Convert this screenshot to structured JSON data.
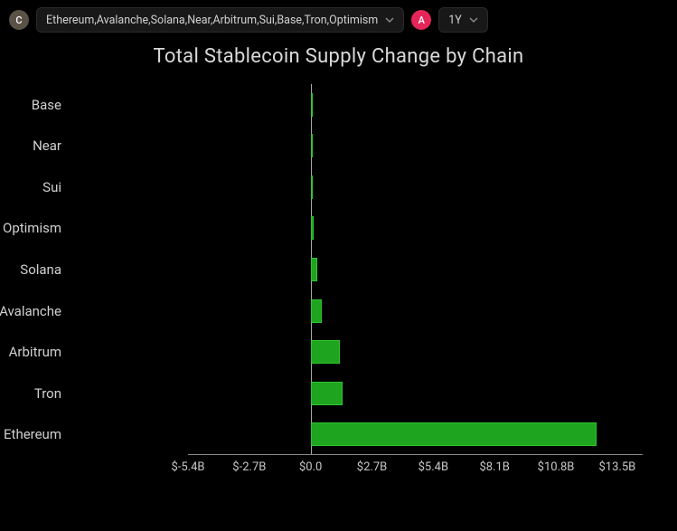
{
  "toolbar": {
    "badge_c": "C",
    "chains_dropdown": "Ethereum,Avalanche,Solana,Near,Arbitrum,Sui,Base,Tron,Optimism",
    "badge_a": "A",
    "range_dropdown": "1Y"
  },
  "chart_data": {
    "type": "bar",
    "orientation": "horizontal",
    "title": "Total Stablecoin Supply Change by Chain",
    "xlabel": "",
    "ylabel": "",
    "x_ticks": [
      "$-5.4B",
      "$-2.7B",
      "$0.0",
      "$2.7B",
      "$5.4B",
      "$8.1B",
      "$10.8B",
      "$13.5B"
    ],
    "x_tick_values": [
      -5.4,
      -2.7,
      0.0,
      2.7,
      5.4,
      8.1,
      10.8,
      13.5
    ],
    "xlim": [
      -5.4,
      14.5
    ],
    "categories": [
      "Base",
      "Near",
      "Sui",
      "Optimism",
      "Solana",
      "Avalanche",
      "Arbitrum",
      "Tron",
      "Ethereum"
    ],
    "values": [
      0.0,
      0.0,
      0.0,
      0.15,
      0.3,
      0.5,
      1.3,
      1.4,
      12.6
    ],
    "bar_color": "#1fa41f"
  }
}
